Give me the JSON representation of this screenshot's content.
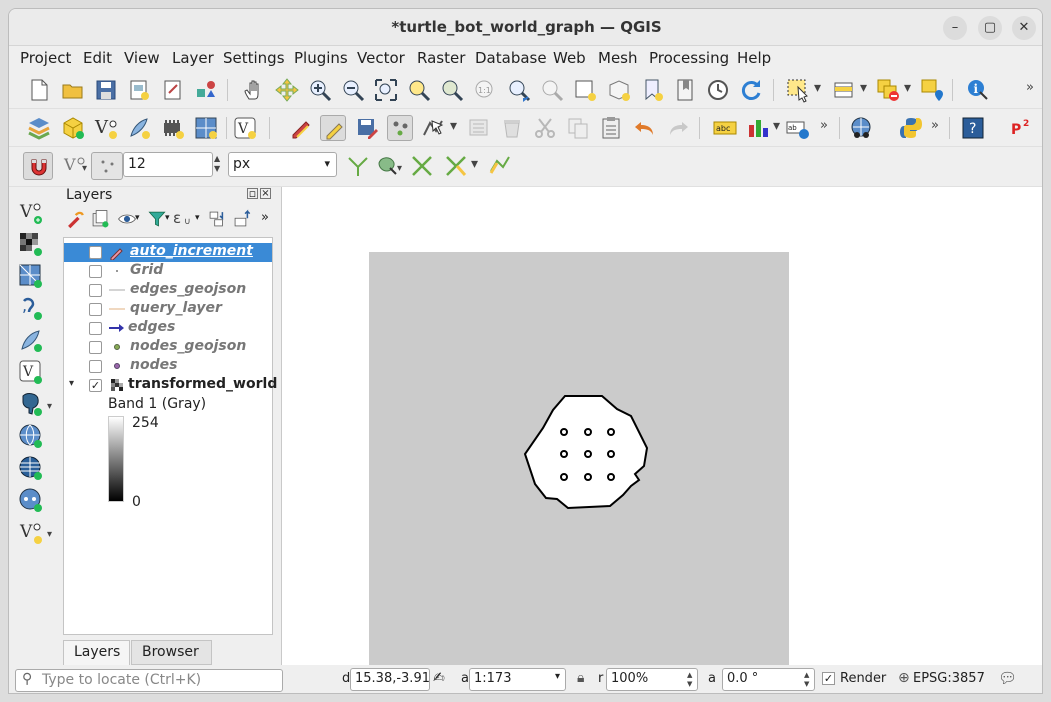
{
  "window": {
    "title": "*turtle_bot_world_graph — QGIS",
    "minimize": "–",
    "maximize": "▢",
    "close": "✕"
  },
  "menu": [
    "Project",
    "Edit",
    "View",
    "Layer",
    "Settings",
    "Plugins",
    "Vector",
    "Raster",
    "Database",
    "Web",
    "Mesh",
    "Processing",
    "Help"
  ],
  "snapping": {
    "tolerance_value": "12",
    "units_value": "px"
  },
  "panel": {
    "title": "Layers",
    "layers": [
      {
        "label": "auto_increment",
        "checked": false,
        "selected": true
      },
      {
        "label": "Grid",
        "checked": false
      },
      {
        "label": "edges_geojson",
        "checked": false
      },
      {
        "label": "query_layer",
        "checked": false
      },
      {
        "label": "edges",
        "checked": false
      },
      {
        "label": "nodes_geojson",
        "checked": false
      },
      {
        "label": "nodes",
        "checked": false
      },
      {
        "label": "transformed_world",
        "checked": true
      }
    ],
    "band_label": "Band 1 (Gray)",
    "legend_max": "254",
    "legend_min": "0",
    "tabs": [
      "Layers",
      "Browser"
    ]
  },
  "status": {
    "locate_placeholder": "Type to locate (Ctrl+K)",
    "coordinate_label": "d",
    "coordinate_value": "15.38,-3.91",
    "scale_label": "a",
    "scale_value": "1:173",
    "magnifier_label": "r",
    "magnifier_value": "100%",
    "rotation_label": "a",
    "rotation_value": "0.0 °",
    "render_label": "Render",
    "crs_label": "EPSG:3857"
  },
  "colors": {
    "selection": "#3a8ad6",
    "raster_bg": "#cbcbcb"
  }
}
